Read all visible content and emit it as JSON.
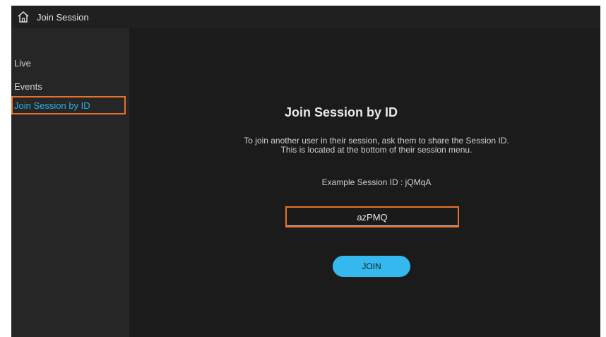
{
  "header": {
    "title": "Join Session",
    "icon": "home-icon"
  },
  "sidebar": {
    "items": [
      {
        "label": "Live",
        "selected": false
      },
      {
        "label": "Events",
        "selected": false
      },
      {
        "label": "Join Session by ID",
        "selected": true
      }
    ]
  },
  "main": {
    "title": "Join Session by ID",
    "description": "To join another user in their session, ask them to share the Session ID. This is located at the bottom of their session menu.",
    "example": "Example Session ID : jQMqA",
    "session_input_value": "azPMQ",
    "join_label": "JOIN"
  },
  "colors": {
    "accent": "#33b9ee",
    "selected_text": "#2fb0e8",
    "focus_border": "#e8702a",
    "background": "#1b1b1b",
    "sidebar": "#262626"
  }
}
